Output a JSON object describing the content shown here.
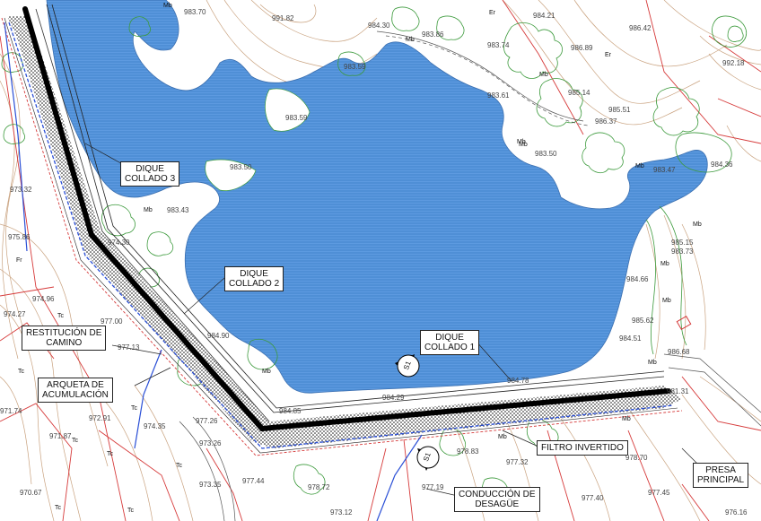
{
  "labels": {
    "dique3_l1": "DIQUE",
    "dique3_l2": "COLLADO 3",
    "dique2_l1": "DIQUE",
    "dique2_l2": "COLLADO 2",
    "dique1_l1": "DIQUE",
    "dique1_l2": "COLLADO 1",
    "restitucion_l1": "RESTITUCIÓN DE",
    "restitucion_l2": "CAMINO",
    "arqueta_l1": "ARQUETA DE",
    "arqueta_l2": "ACUMULACIÓN",
    "filtro": "FILTRO INVERTIDO",
    "presa_l1": "PRESA",
    "presa_l2": "PRINCIPAL",
    "conduccion_l1": "CONDUCCIÓN DE",
    "conduccion_l2": "DESAGÜE"
  },
  "section_marker": "S1",
  "colors": {
    "water": "#4f8fd6",
    "contour": "#c9a27f",
    "vegetation": "#3c9a3c",
    "parcel": "#d63a3a",
    "drain": "#2a4fd6",
    "crest": "#000000"
  },
  "elevations": {
    "e1": "983.70",
    "e2": "991.82",
    "e3": "984.30",
    "e4": "983.86",
    "e5": "983.74",
    "e6": "984.21",
    "e7": "986.42",
    "e8": "986.89",
    "e9": "992.18",
    "e10": "983.59",
    "e11": "983.61",
    "e12": "985.14",
    "e13": "985.51",
    "e14": "986.37",
    "e15": "983.59",
    "e16": "983.50",
    "e17": "983.47",
    "e18": "984.36",
    "e19": "983.50",
    "e20": "983.43",
    "e21": "973.32",
    "e22": "975.86",
    "e23": "974.30",
    "e24": "974.96",
    "e25": "974.27",
    "e26": "977.00",
    "e27": "977.13",
    "e28": "984.90",
    "e29": "984.66",
    "e30": "985.62",
    "e31": "984.51",
    "e32": "986.68",
    "e33": "981.31",
    "e34": "984.78",
    "e35": "984.29",
    "e36": "984.85",
    "e37": "972.91",
    "e38": "971.87",
    "e39": "974.35",
    "e40": "971.74",
    "e41": "977.26",
    "e42": "973.26",
    "e43": "973.35",
    "e44": "977.44",
    "e45": "978.72",
    "e46": "977.19",
    "e47": "978.83",
    "e48": "977.32",
    "e49": "977.40",
    "e50": "977.45",
    "e51": "970.67",
    "e52": "973.12",
    "e53": "976.16",
    "e54": "978.70",
    "e55": "985.15",
    "e56": "983.73"
  },
  "veg": {
    "mb": "Mb",
    "er": "Er",
    "fr": "Fr",
    "tc": "Tc"
  }
}
